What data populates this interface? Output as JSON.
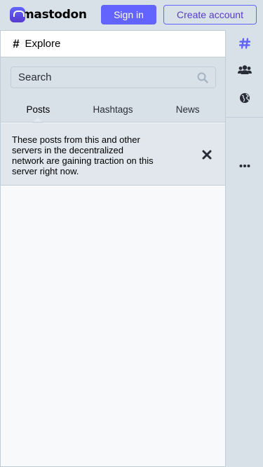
{
  "app": {
    "logo_text": "mastodon",
    "brand_color": "#6364ff"
  },
  "header": {
    "sign_in_label": "Sign in",
    "create_account_label": "Create account"
  },
  "column": {
    "icon": "hashtag-icon",
    "title": "Explore"
  },
  "search": {
    "placeholder": "Search",
    "icon": "search-icon"
  },
  "tabs": [
    {
      "label": "Posts",
      "active": true
    },
    {
      "label": "Hashtags",
      "active": false
    },
    {
      "label": "News",
      "active": false
    }
  ],
  "notice": {
    "text": "These posts from this and other servers in the decentralized network are gaining traction on this server right now.",
    "dismiss_icon": "close-icon"
  },
  "rail": {
    "items": [
      {
        "icon": "hashtag-icon",
        "active": true
      },
      {
        "icon": "people-icon",
        "active": false
      },
      {
        "icon": "globe-icon",
        "active": false
      },
      {
        "icon": "more-icon",
        "active": false
      }
    ]
  }
}
